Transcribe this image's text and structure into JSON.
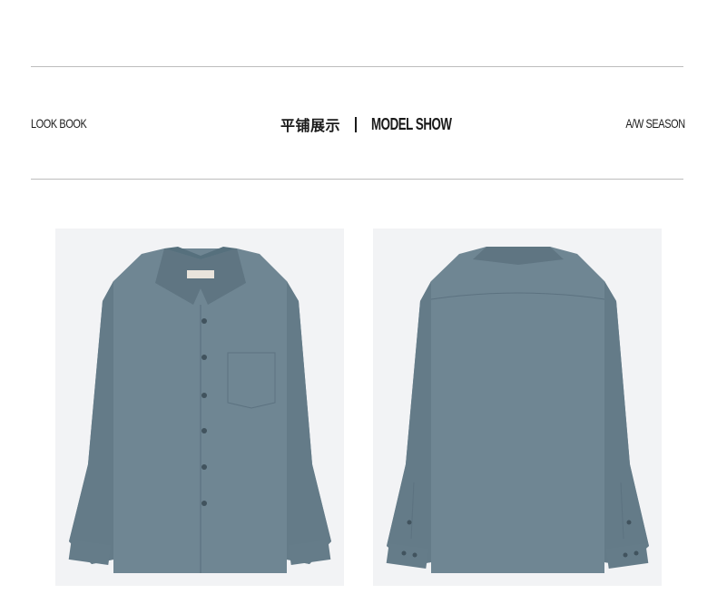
{
  "header": {
    "left_label": "LOOK BOOK",
    "title_cn": "平铺展示",
    "title_en": "MODEL SHOW",
    "right_label": "A/W SEASON"
  },
  "colors": {
    "shirt": "#6f8693",
    "shirt_shadow": "#5f7582",
    "panel_bg": "#f2f3f5",
    "rule": "#bdbdbd",
    "text": "#1a1a1a"
  },
  "images": [
    {
      "name": "shirt-front-image",
      "view": "front"
    },
    {
      "name": "shirt-back-image",
      "view": "back"
    }
  ]
}
